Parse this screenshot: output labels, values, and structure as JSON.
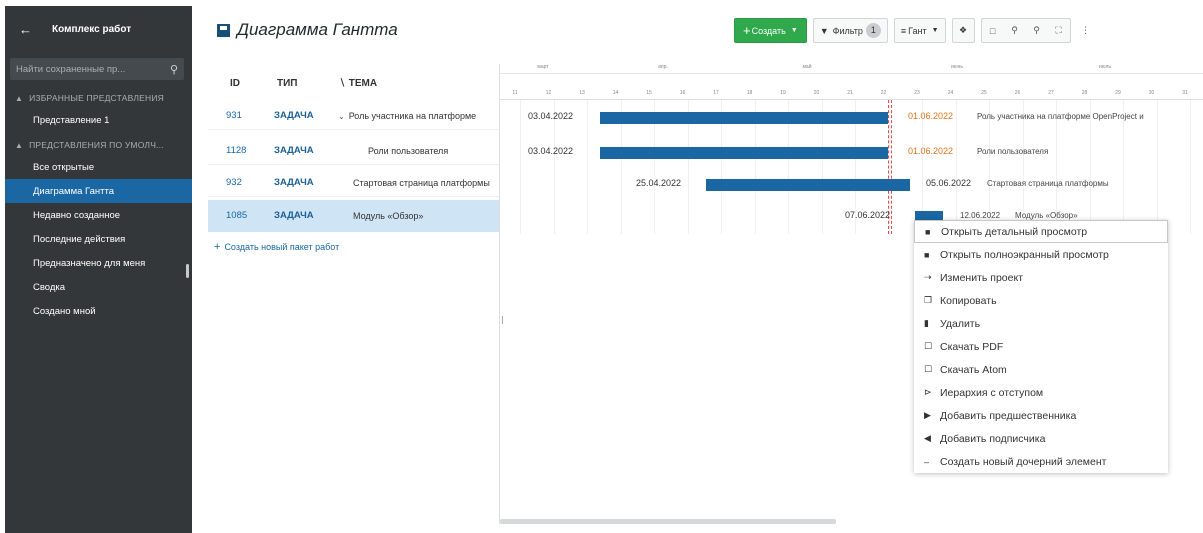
{
  "sidebar": {
    "back_icon": "arrow-left-icon",
    "title": "Комплекс работ",
    "search_placeholder": "Найти сохраненные пр...",
    "groups": [
      {
        "label": "ИЗБРАННЫЕ ПРЕДСТАВЛЕНИЯ"
      },
      {
        "label": "ПРЕДСТАВЛЕНИЯ ПО УМОЛЧ..."
      }
    ],
    "favorite_items": [
      "Представление 1"
    ],
    "default_items": [
      "Все открытые",
      "Диаграмма Гантта",
      "Недавно созданное",
      "Последние действия",
      "Предназначено для меня",
      "Сводка",
      "Создано мной"
    ],
    "active_item": "Диаграмма Гантта"
  },
  "header": {
    "title": "Диаграмма Гантта",
    "create_label": "Создать",
    "filter_label": "Фильтр",
    "filter_count": "1",
    "view_label": "Гант"
  },
  "table": {
    "columns": [
      "ID",
      "ТИП",
      "ТЕМА"
    ],
    "rows": [
      {
        "id": "931",
        "type": "ЗАДАЧА",
        "subject": "Роль участника на платформе",
        "expanded": true
      },
      {
        "id": "1128",
        "type": "ЗАДАЧА",
        "subject": "Роли пользователя"
      },
      {
        "id": "932",
        "type": "ЗАДАЧА",
        "subject": "Стартовая страница платформы"
      },
      {
        "id": "1085",
        "type": "ЗАДАЧА",
        "subject": "Модуль «Обзор»",
        "selected": true
      }
    ],
    "add_label": "Создать новый пакет работ"
  },
  "gantt": {
    "months": [
      "март",
      "апр.",
      "май",
      "июнь",
      "июль"
    ],
    "days": [
      "11",
      "12",
      "13",
      "14",
      "15",
      "16",
      "17",
      "18",
      "19",
      "20",
      "21",
      "22",
      "23",
      "24",
      "25",
      "26",
      "27",
      "28",
      "29",
      "30",
      "31"
    ],
    "bars": [
      {
        "start": "03.04.2022",
        "end": "01.06.2022",
        "label": "Роль участника на платформе OpenProject и",
        "end_late": true
      },
      {
        "start": "03.04.2022",
        "end": "01.06.2022",
        "label": "Роли пользователя",
        "end_late": true
      },
      {
        "start": "25.04.2022",
        "end": "05.06.2022",
        "label": "Стартовая страница платформы",
        "end_late": false
      },
      {
        "start": "07.06.2022",
        "end": "12.06.2022",
        "label": "Модуль «Обзор»",
        "end_late": false
      }
    ]
  },
  "context_menu": {
    "items": [
      {
        "label": "Открыть детальный просмотр",
        "icon": "details-view-icon"
      },
      {
        "label": "Открыть полноэкранный просмотр",
        "icon": "fullscreen-view-icon"
      },
      {
        "label": "Изменить проект",
        "icon": "move-project-icon"
      },
      {
        "label": "Копировать",
        "icon": "copy-icon"
      },
      {
        "label": "Удалить",
        "icon": "trash-icon"
      },
      {
        "label": "Скачать PDF",
        "icon": "pdf-file-icon"
      },
      {
        "label": "Скачать Atom",
        "icon": "atom-file-icon"
      },
      {
        "label": "Иерархия с отступом",
        "icon": "indent-hierarchy-icon"
      },
      {
        "label": "Добавить предшественника",
        "icon": "add-predecessor-icon"
      },
      {
        "label": "Добавить подписчика",
        "icon": "add-follower-icon"
      },
      {
        "label": "Создать новый дочерний элемент",
        "icon": "add-child-icon"
      }
    ]
  }
}
